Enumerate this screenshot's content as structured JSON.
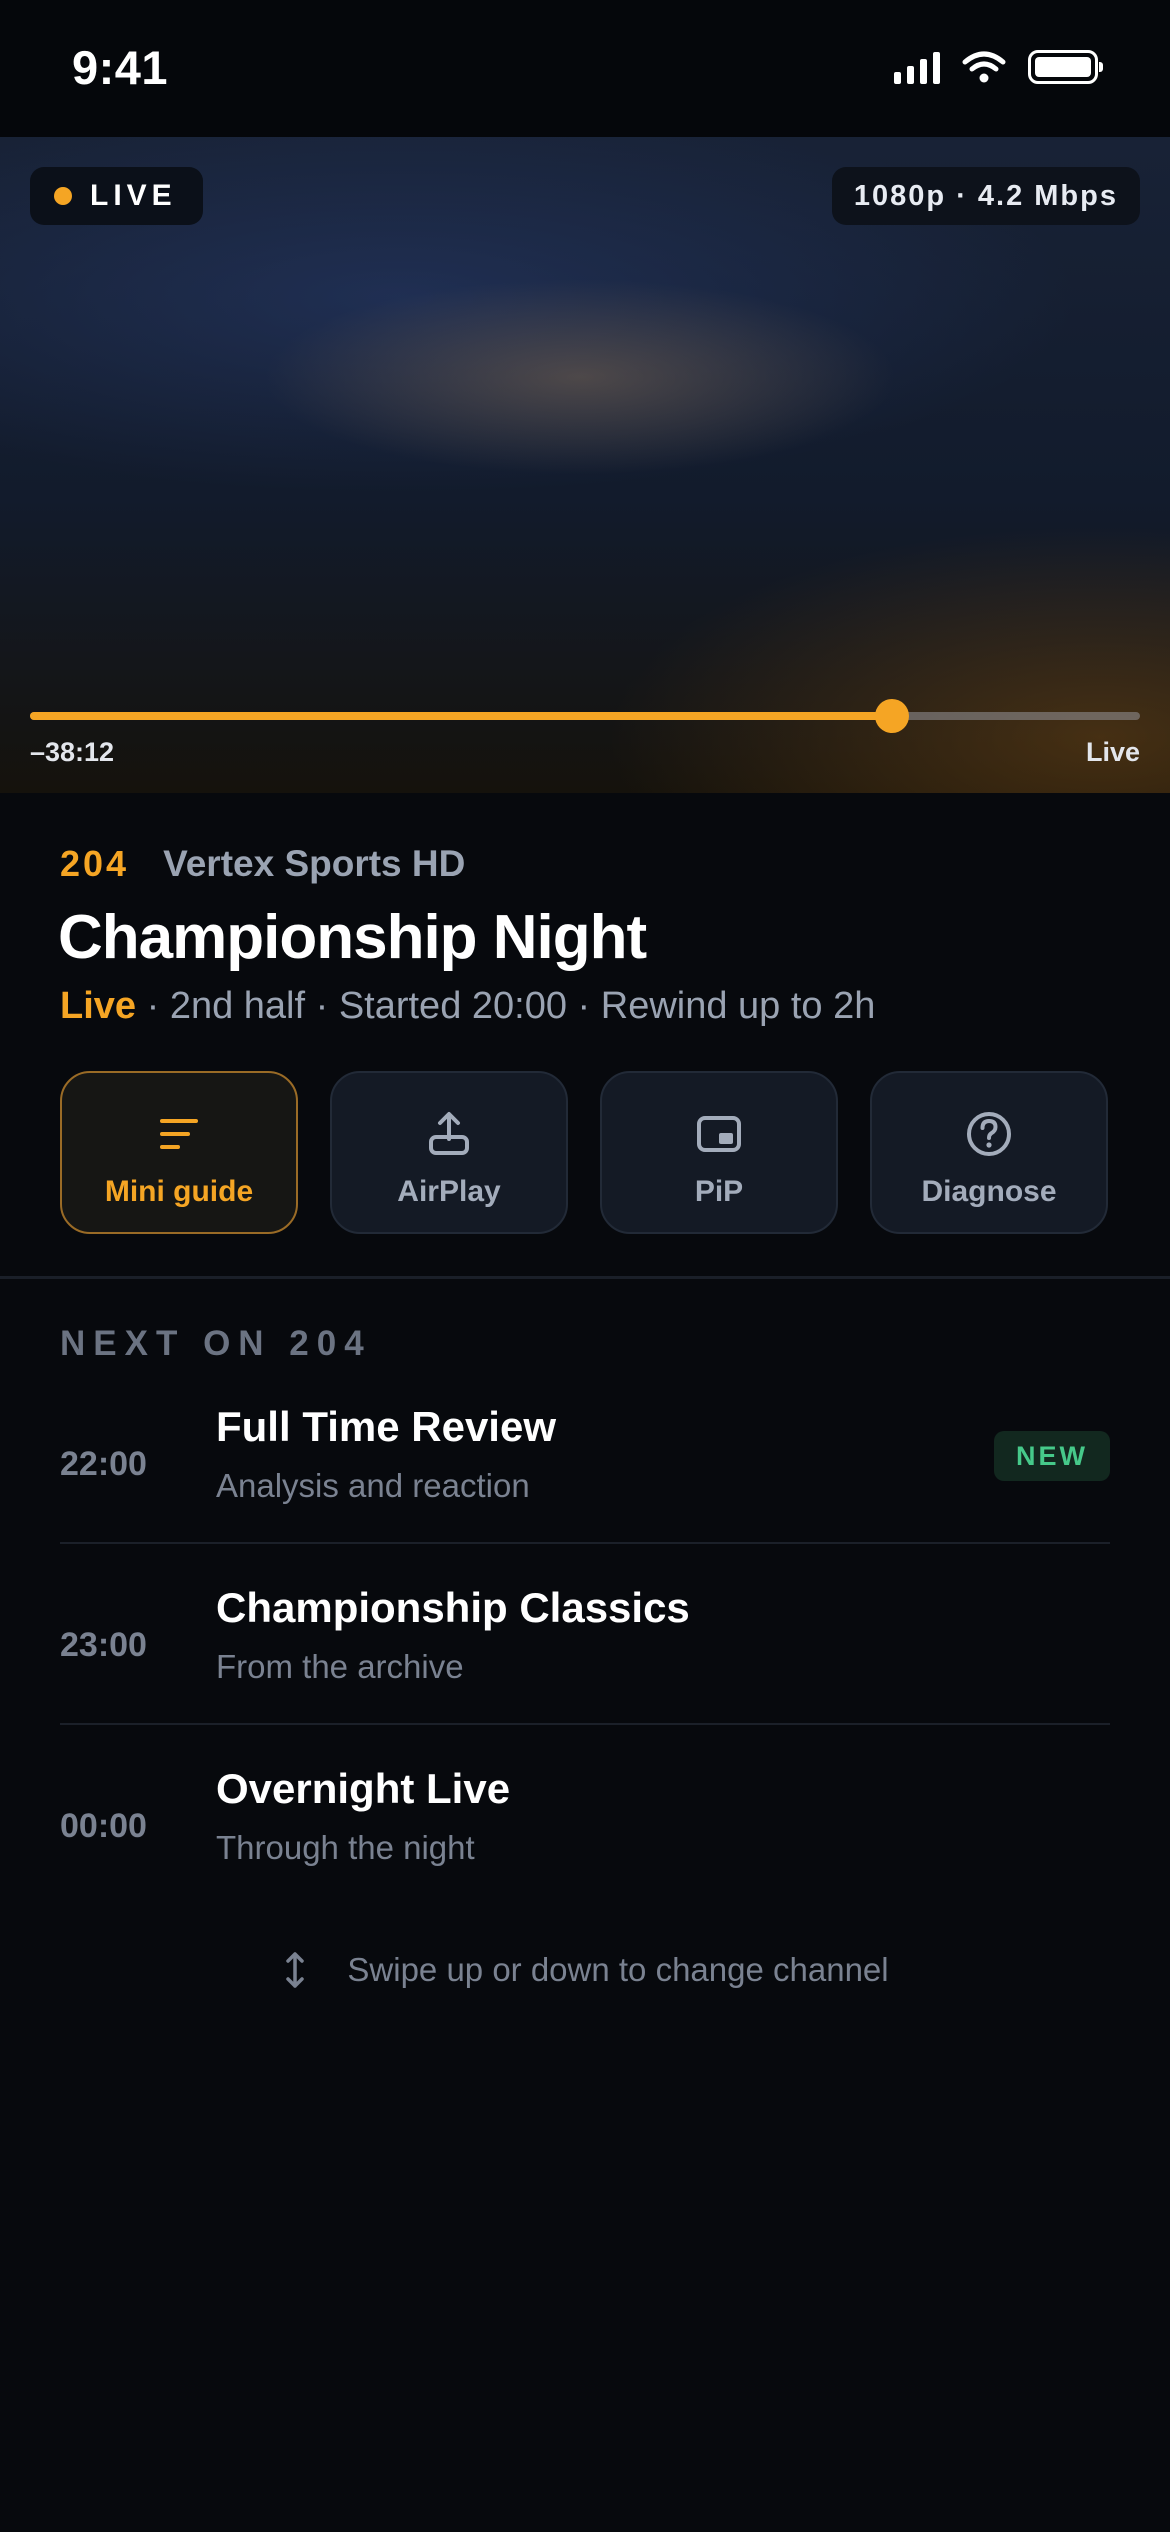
{
  "status_bar": {
    "time": "9:41",
    "icons": [
      "signal-icon",
      "wifi-icon",
      "battery-icon"
    ]
  },
  "player": {
    "live_badge": "LIVE",
    "quality": "1080p · 4.2 Mbps",
    "progress_fraction": 0.777,
    "time_left": "–38:12",
    "time_right": "Live"
  },
  "channel": {
    "number": "204",
    "name": "Vertex Sports HD"
  },
  "program": {
    "title": "Championship Night",
    "status": "Live",
    "details": " · 2nd half · Started 20:00 · Rewind up to 2h"
  },
  "actions": [
    {
      "label": "Mini guide",
      "icon": "list-icon",
      "active": true
    },
    {
      "label": "AirPlay",
      "icon": "share-icon",
      "active": false
    },
    {
      "label": "PiP",
      "icon": "pip-icon",
      "active": false
    },
    {
      "label": "Diagnose",
      "icon": "question-icon",
      "active": false
    }
  ],
  "next": {
    "heading": "NEXT ON 204",
    "items": [
      {
        "time": "22:00",
        "title": "Full Time Review",
        "subtitle": "Analysis and reaction",
        "badge": "NEW"
      },
      {
        "time": "23:00",
        "title": "Championship Classics",
        "subtitle": "From the archive"
      },
      {
        "time": "00:00",
        "title": "Overnight Live",
        "subtitle": "Through the night"
      }
    ]
  },
  "hint": "Swipe up or down to change channel",
  "colors": {
    "accent": "#f5a524",
    "background": "#07090d",
    "new_badge": "#46c98a"
  }
}
